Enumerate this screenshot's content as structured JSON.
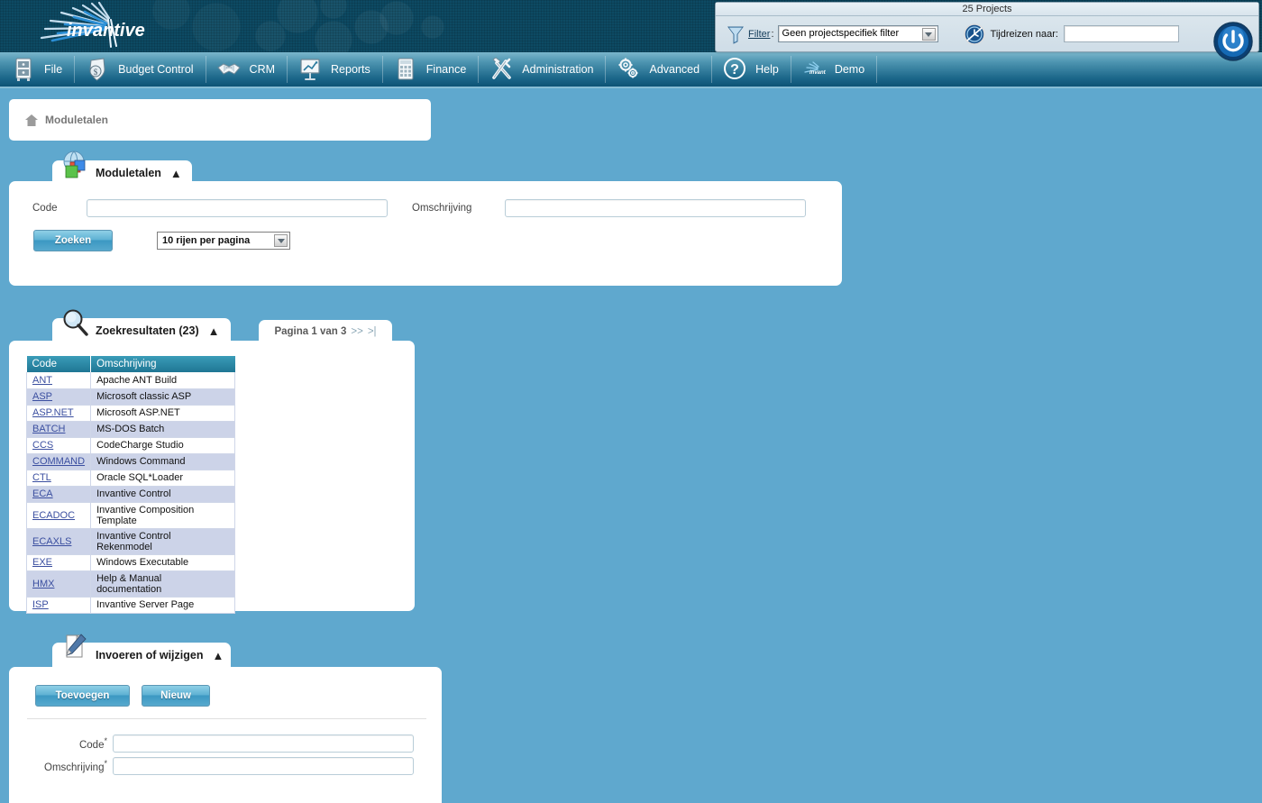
{
  "header": {
    "logo_text": "invantive",
    "logo_icon": "invantive-burst-logo"
  },
  "projects_box": {
    "title": "25 Projects",
    "filter_icon": "funnel-icon",
    "filter_label": "Filter",
    "filter_colon": ":",
    "filter_value": "Geen projectspecifiek filter",
    "filter_options": [
      "Geen projectspecifiek filter"
    ],
    "clock_icon": "time-travel-clock-icon",
    "timetravel_label": "Tijdreizen naar:",
    "timetravel_value": "",
    "timetravel_placeholder": "",
    "power_icon": "power-button-icon"
  },
  "menu": {
    "items": [
      {
        "label": "File",
        "icon": "cabinet-icon"
      },
      {
        "label": "Budget Control",
        "icon": "money-shield-icon"
      },
      {
        "label": "CRM",
        "icon": "handshake-icon"
      },
      {
        "label": "Reports",
        "icon": "presentation-chart-icon"
      },
      {
        "label": "Finance",
        "icon": "calculator-icon"
      },
      {
        "label": "Administration",
        "icon": "tools-wrench-icon"
      },
      {
        "label": "Advanced",
        "icon": "gears-icon"
      },
      {
        "label": "Help",
        "icon": "question-mark-icon"
      },
      {
        "label": "Demo",
        "icon": "invantive-small-icon"
      }
    ]
  },
  "breadcrumb": {
    "home_icon": "home-icon",
    "text": "Moduletalen"
  },
  "search_panel": {
    "tab_icon": "globe-windows-icon",
    "title": "Moduletalen",
    "collapse_icon": "chevron-up-icon",
    "code_label": "Code",
    "code_value": "",
    "omschrijving_label": "Omschrijving",
    "omschrijving_value": "",
    "search_button": "Zoeken",
    "rows_select_value": "10 rijen per pagina",
    "rows_select_options": [
      "10 rijen per pagina"
    ]
  },
  "results_panel": {
    "tab_icon": "magnifier-icon",
    "title": "Zoekresultaten (23)",
    "collapse_icon": "chevron-up-icon",
    "page_label": "Pagina 1 van 3",
    "page_next": ">>",
    "page_last": ">|",
    "columns": [
      "Code",
      "Omschrijving"
    ],
    "rows": [
      {
        "code": "ANT",
        "omschrijving": "Apache ANT Build"
      },
      {
        "code": "ASP",
        "omschrijving": "Microsoft classic ASP"
      },
      {
        "code": "ASP.NET",
        "omschrijving": "Microsoft ASP.NET"
      },
      {
        "code": "BATCH",
        "omschrijving": "MS-DOS Batch"
      },
      {
        "code": "CCS",
        "omschrijving": "CodeCharge Studio"
      },
      {
        "code": "COMMAND",
        "omschrijving": "Windows Command"
      },
      {
        "code": "CTL",
        "omschrijving": "Oracle SQL*Loader"
      },
      {
        "code": "ECA",
        "omschrijving": "Invantive Control"
      },
      {
        "code": "ECADOC",
        "omschrijving": "Invantive Composition Template"
      },
      {
        "code": "ECAXLS",
        "omschrijving": "Invantive Control Rekenmodel"
      },
      {
        "code": "EXE",
        "omschrijving": "Windows Executable"
      },
      {
        "code": "HMX",
        "omschrijving": "Help & Manual documentation"
      },
      {
        "code": "ISP",
        "omschrijving": "Invantive Server Page"
      }
    ]
  },
  "edit_panel": {
    "tab_icon": "notepad-pencil-icon",
    "title": "Invoeren of wijzigen",
    "collapse_icon": "chevron-up-icon",
    "add_button": "Toevoegen",
    "new_button": "Nieuw",
    "code_label": "Code",
    "code_required": "*",
    "code_value": "",
    "omschrijving_label": "Omschrijving",
    "omschrijving_required": "*",
    "omschrijving_value": ""
  },
  "colors": {
    "page_background": "#5FA8CE",
    "banner_dark": "#0D4A63",
    "menu_gradient_top": "#7AB6CB",
    "menu_gradient_bottom": "#0D5275",
    "table_header": "#2D8CA8",
    "table_row_alt": "#CCD3E8",
    "link": "#3B4FA0",
    "button_blue": "#5FB2D4"
  }
}
